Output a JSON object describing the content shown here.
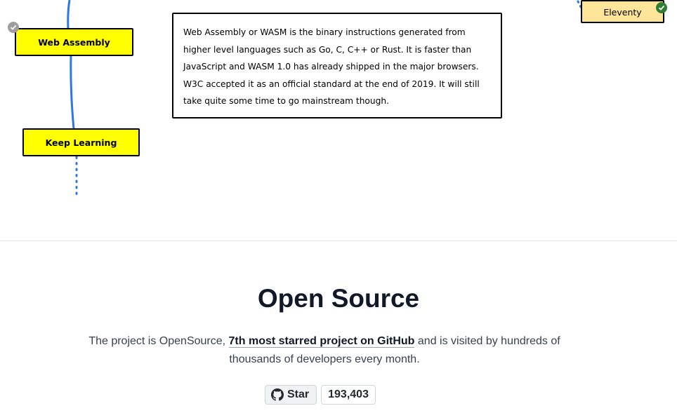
{
  "roadmap": {
    "nodes": {
      "web_assembly": "Web Assembly",
      "keep_learning": "Keep Learning",
      "eleventy": "Eleventy"
    },
    "note_text": "Web Assembly or WASM is the binary instructions generated from higher level languages such as Go, C, C++ or Rust. It is faster than JavaScript and WASM 1.0 has already shipped in the major browsers. W3C accepted it as an official standard at the end of 2019. It will still take quite some time to go mainstream though.",
    "colors": {
      "node_fill": "#ffff00",
      "node_light_fill": "#ffe599",
      "connector": "#2b78e4",
      "check_done": "#2e7d32",
      "check_pending": "#9e9e9e"
    }
  },
  "open_source": {
    "title": "Open Source",
    "desc_prefix": "The project is OpenSource, ",
    "desc_link": "7th most starred project on GitHub",
    "desc_suffix": " and is visited by hundreds of thousands of developers every month."
  },
  "github": {
    "icon": "github-icon",
    "star_label": "Star",
    "star_count": "193,403"
  }
}
